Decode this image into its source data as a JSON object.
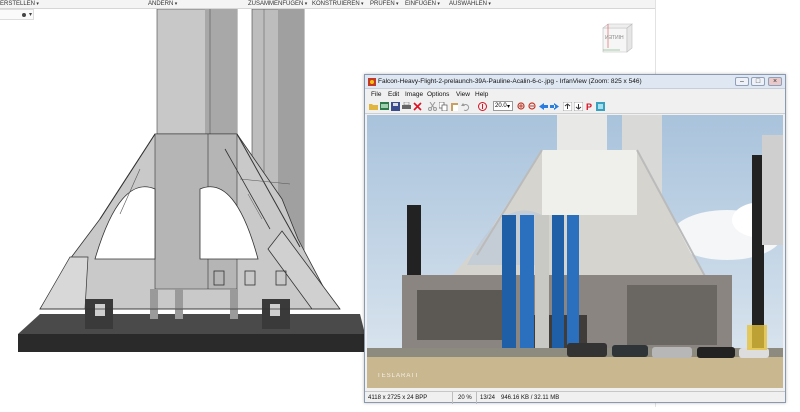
{
  "cad": {
    "menu": [
      {
        "id": "erstellen",
        "label": "ERSTELLEN"
      },
      {
        "id": "aendern",
        "label": "ÄNDERN"
      },
      {
        "id": "zusammenfuegen",
        "label": "ZUSAMMENFÜGEN"
      },
      {
        "id": "konstruieren",
        "label": "KONSTRUIEREN"
      },
      {
        "id": "pruefen",
        "label": "PRÜFEN"
      },
      {
        "id": "einfuegen",
        "label": "EINFÜGEN"
      },
      {
        "id": "auswaehlen",
        "label": "AUSWÄHLEN"
      }
    ],
    "viewcube_label": "HINTEN"
  },
  "irfanview": {
    "title": "Falcon-Heavy-Flight-2-prelaunch-39A-Pauline-Acalin-6-c-.jpg - IrfanView (Zoom: 825 x 546)",
    "menu": [
      "File",
      "Edit",
      "Image",
      "Options",
      "View",
      "Help"
    ],
    "zoom_value": "20.0",
    "watermark": "TESLARATI",
    "status": {
      "dimensions": "4118 x 2725 x 24 BPP",
      "zoom": "20 %",
      "index": "13/24",
      "filesize": "946.16 KB / 32.11 MB"
    }
  },
  "colors": {
    "accent_blue": "#1f5fa8",
    "window_border": "#8a99b0",
    "cad_gray": "#b9b9b9"
  }
}
